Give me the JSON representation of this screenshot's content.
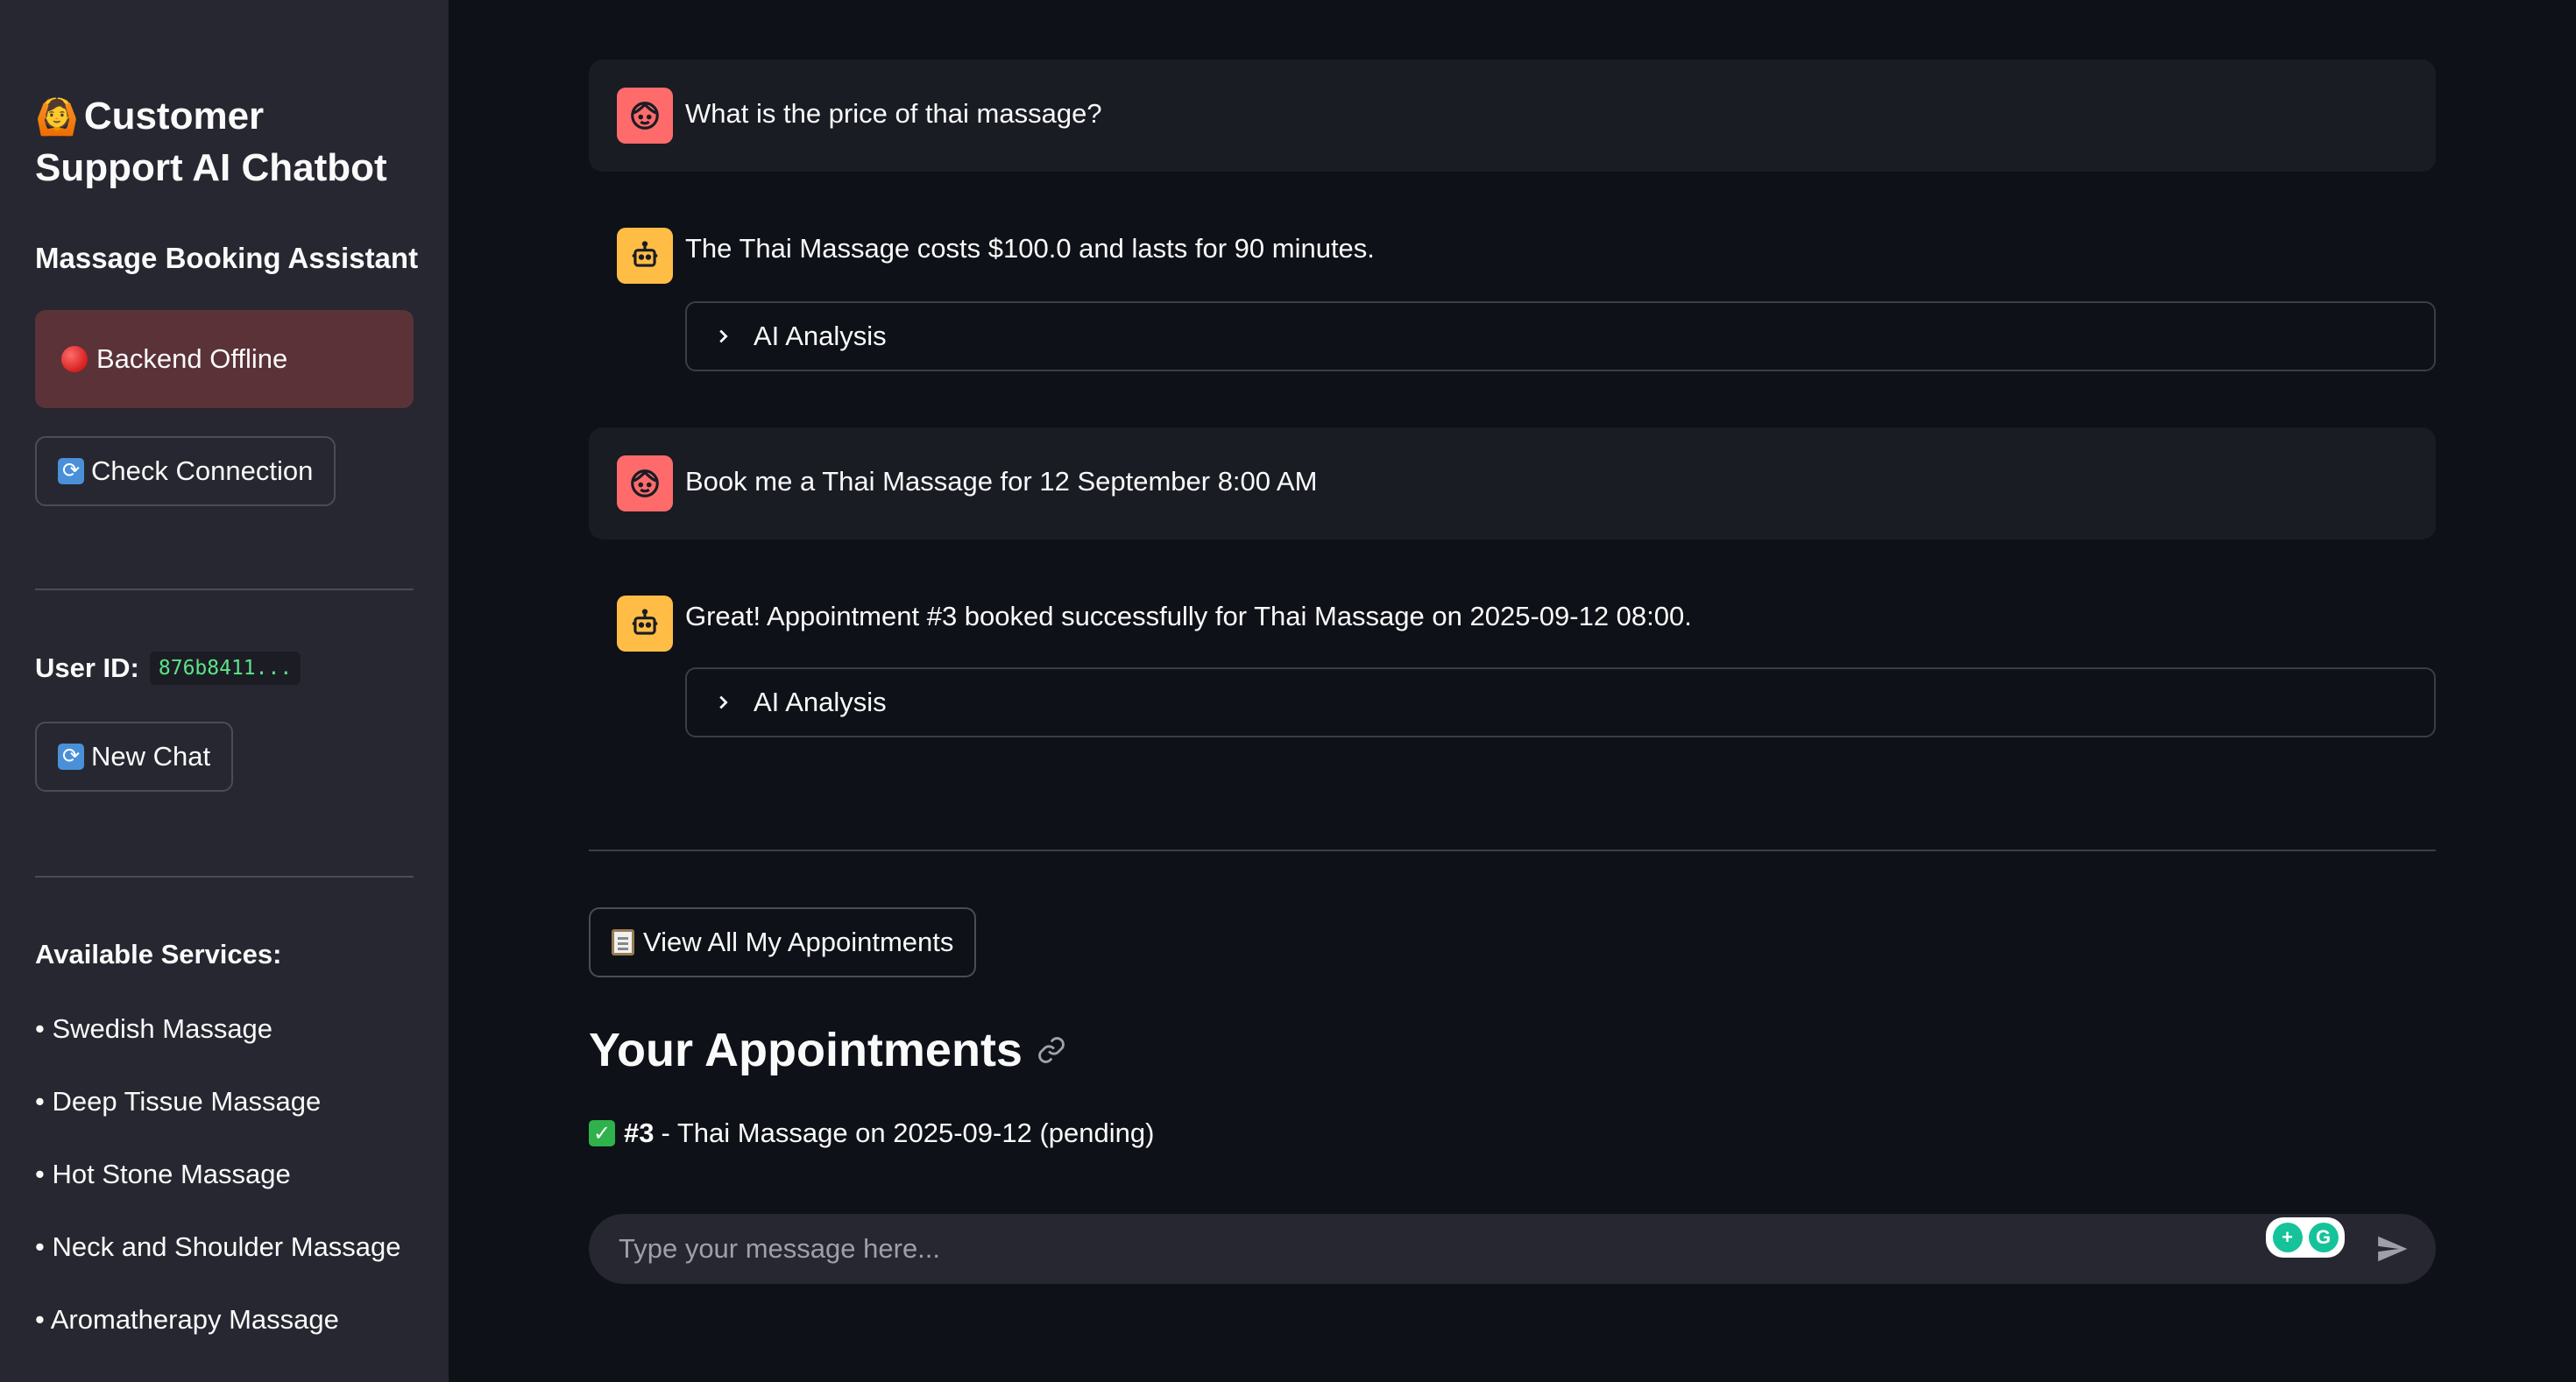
{
  "sidebar": {
    "title_emoji": "🙆",
    "title": "Customer Support AI Chatbot",
    "subtitle": "Massage Booking Assistant",
    "status": "Backend Offline",
    "check_connection_label": "Check Connection",
    "user_id_label": "User ID:",
    "user_id_value": "876b8411...",
    "new_chat_label": "New Chat",
    "services_title": "Available Services:",
    "services": [
      "• Swedish Massage",
      "• Deep Tissue Massage",
      "• Hot Stone Massage",
      "• Neck and Shoulder Massage",
      "• Aromatherapy Massage"
    ]
  },
  "chat": {
    "messages": [
      {
        "role": "user",
        "text": "What is the price of thai massage?"
      },
      {
        "role": "assistant",
        "text": "The Thai Massage costs $100.0 and lasts for 90 minutes.",
        "expander": "AI Analysis"
      },
      {
        "role": "user",
        "text": "Book me a Thai Massage for 12 September 8:00 AM"
      },
      {
        "role": "assistant",
        "text": "Great! Appointment #3 booked successfully for Thai Massage on 2025-09-12 08:00.",
        "expander": "AI Analysis"
      }
    ]
  },
  "appointments": {
    "view_all_label": "View All My Appointments",
    "heading": "Your Appointments",
    "items": [
      {
        "number": "#3",
        "text": "- Thai Massage on 2025-09-12 (pending)"
      }
    ]
  },
  "input": {
    "placeholder": "Type your message here..."
  },
  "colors": {
    "background": "#0e1117",
    "sidebar": "#262730",
    "user_avatar": "#ff6b6b",
    "assistant_avatar": "#ffbd45",
    "status_offline_bg": "#5a3238",
    "user_id_code": "#5ce488"
  }
}
